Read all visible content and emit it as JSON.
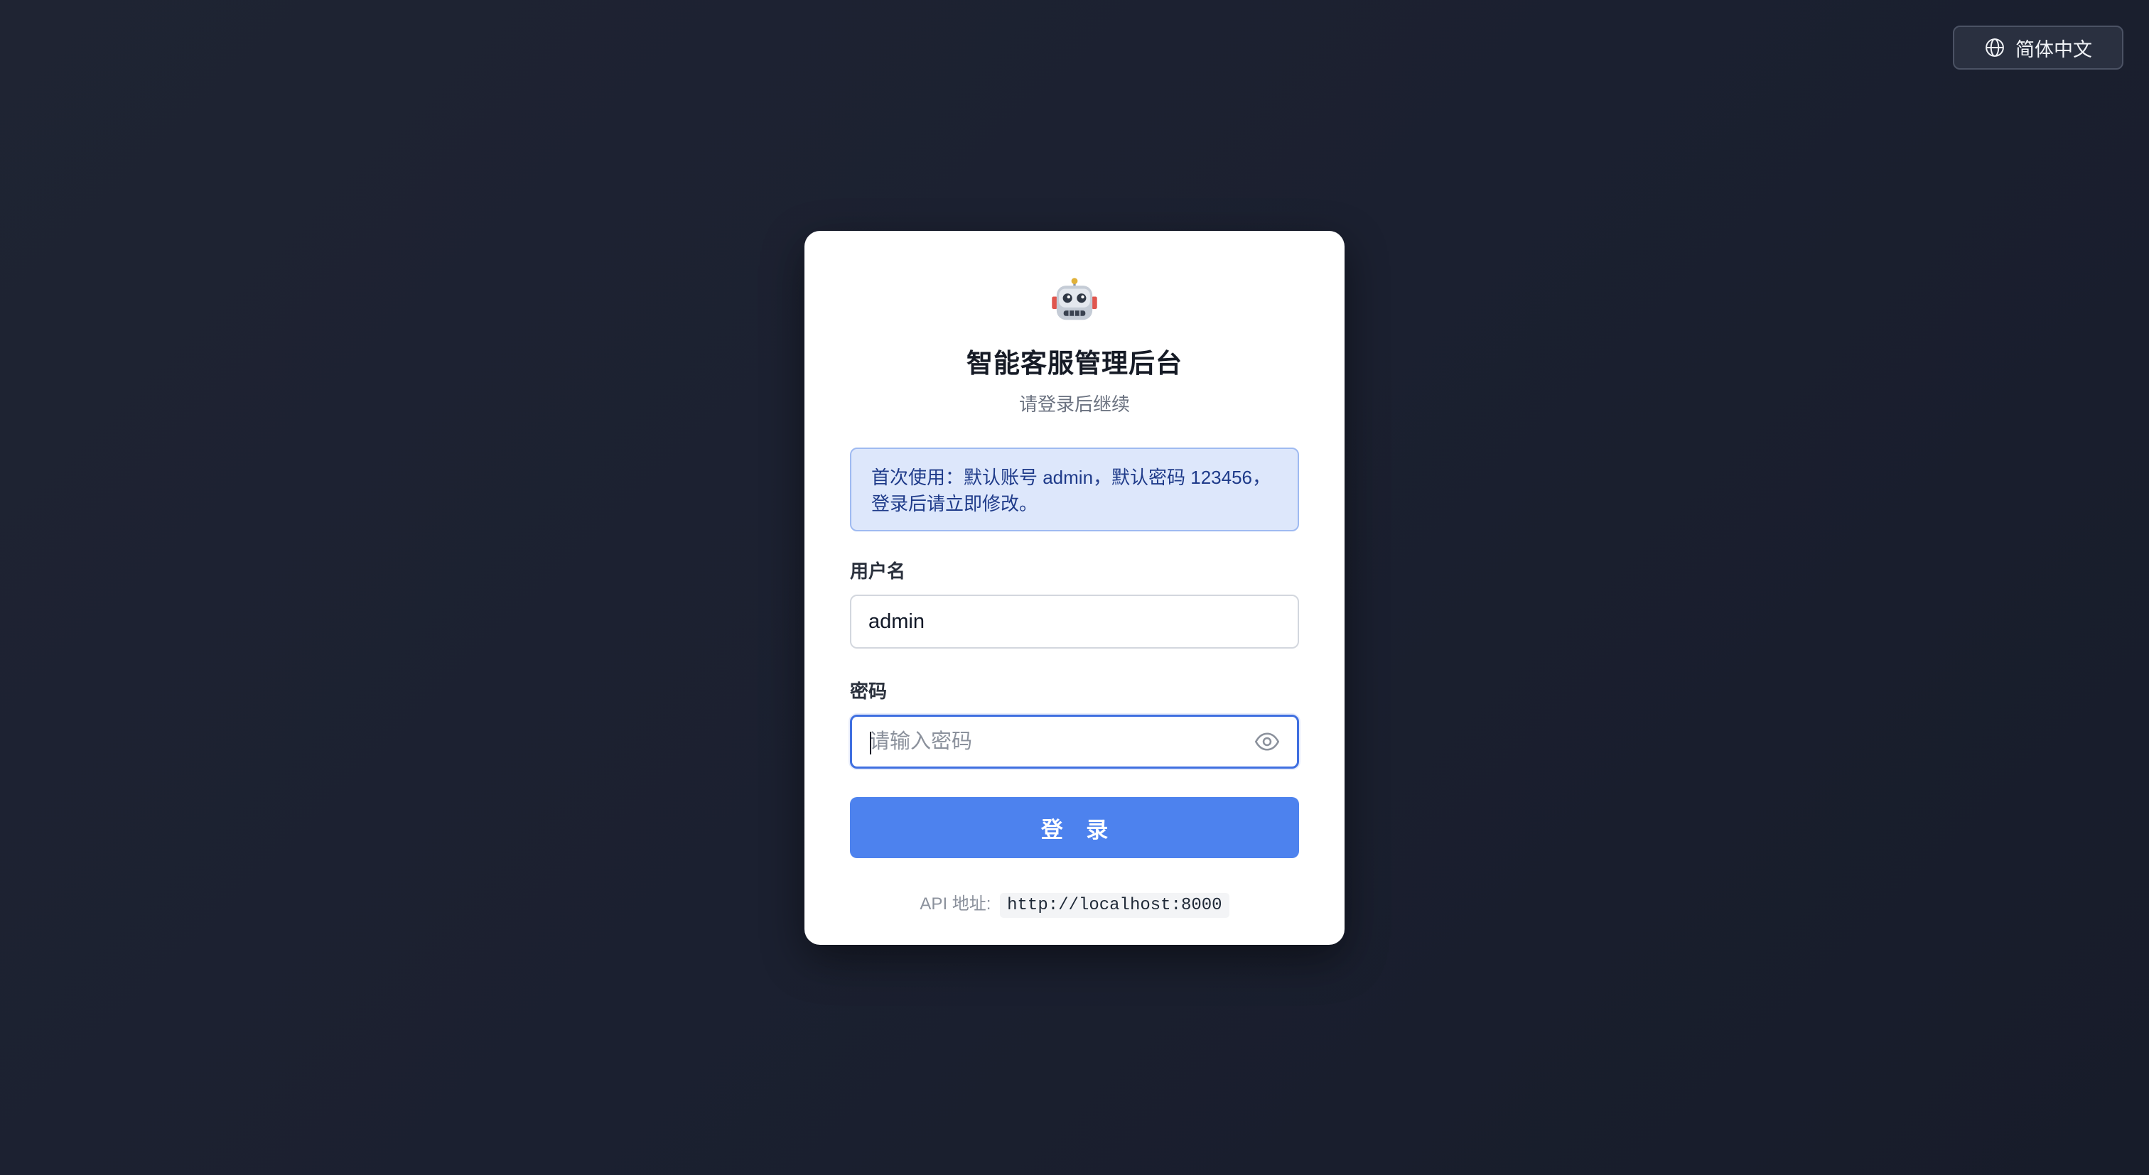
{
  "header": {
    "language_label": "简体中文",
    "language_icon": "globe-icon"
  },
  "login": {
    "logo_icon": "robot-emoji-icon",
    "title": "智能客服管理后台",
    "subtitle": "请登录后继续",
    "notice": "首次使用：默认账号 admin，默认密码 123456，登录后请立即修改。",
    "username": {
      "label": "用户名",
      "value": "admin"
    },
    "password": {
      "label": "密码",
      "placeholder": "请输入密码",
      "value": "",
      "toggle_icon": "eye-icon"
    },
    "submit_label": "登 录",
    "api": {
      "label": "API 地址:",
      "url": "http://localhost:8000"
    }
  },
  "colors": {
    "background": "#1b2030",
    "card": "#ffffff",
    "primary": "#4d82ee",
    "notice_bg": "#dde7fb",
    "notice_text": "#1f3b8a",
    "focus_border": "#3f6fe0"
  }
}
